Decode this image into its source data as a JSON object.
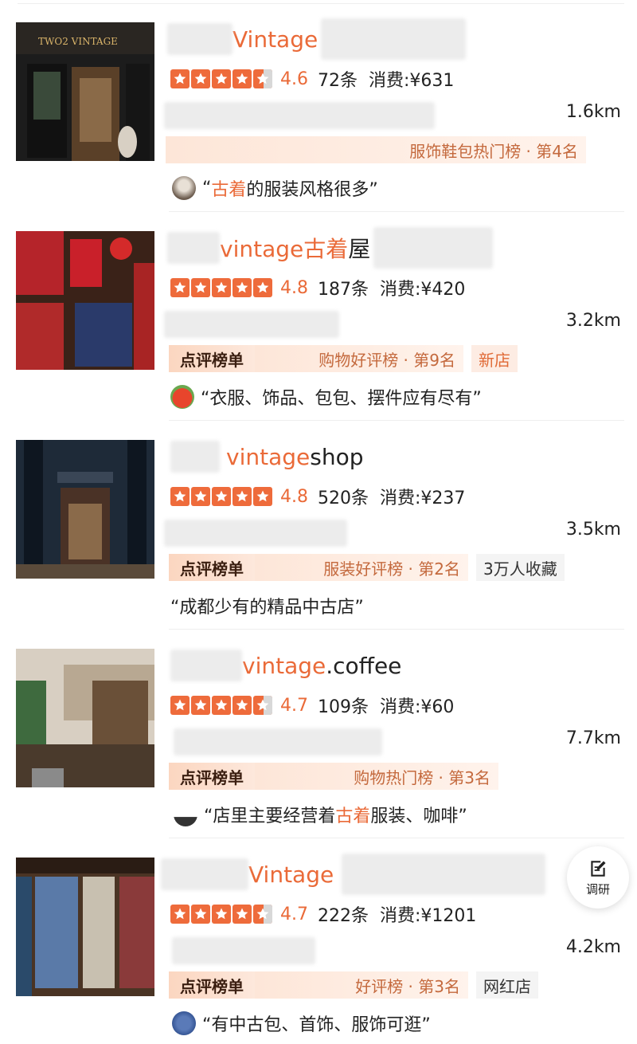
{
  "shops": [
    {
      "name_highlight": "Vintage",
      "name_tail": "",
      "score": "4.6",
      "stars": 4.5,
      "reviews": "72条",
      "price": "消费:¥631",
      "distance": "1.6km",
      "rank_badge": "",
      "rank_text": "服饰鞋包热门榜 · 第4名",
      "extra_tag": "",
      "review_pre": "“",
      "review_hl": "古着",
      "review_post": "的服装风格很多”"
    },
    {
      "name_highlight": "vintage古着",
      "name_tail": "屋",
      "score": "4.8",
      "stars": 5,
      "reviews": "187条",
      "price": "消费:¥420",
      "distance": "3.2km",
      "rank_badge": "点评榜单",
      "rank_text": "购物好评榜 · 第9名",
      "extra_tag": "新店",
      "review_pre": "“衣服、饰品、包包、摆件应有尽有”",
      "review_hl": "",
      "review_post": ""
    },
    {
      "name_highlight": "vintage",
      "name_tail": " shop",
      "score": "4.8",
      "stars": 5,
      "reviews": "520条",
      "price": "消费:¥237",
      "distance": "3.5km",
      "rank_badge": "点评榜单",
      "rank_text": "服装好评榜 · 第2名",
      "extra_tag": "3万人收藏",
      "review_pre": "“成都少有的精品中古店”",
      "review_hl": "",
      "review_post": ""
    },
    {
      "name_highlight": "vintage",
      "name_tail": ".coffee",
      "score": "4.7",
      "stars": 4.5,
      "reviews": "109条",
      "price": "消费:¥60",
      "distance": "7.7km",
      "rank_badge": "点评榜单",
      "rank_text": "购物热门榜 · 第3名",
      "extra_tag": "",
      "review_pre": "“店里主要经营着",
      "review_hl": "古着",
      "review_post": "服装、咖啡”"
    },
    {
      "name_highlight": "Vintage",
      "name_tail": "",
      "score": "4.7",
      "stars": 4.5,
      "reviews": "222条",
      "price": "消费:¥1201",
      "distance": "4.2km",
      "rank_badge": "点评榜单",
      "rank_text": "好评榜 · 第3名",
      "extra_tag": "网红店",
      "review_pre": "“有中古包、首饰、服饰可逛”",
      "review_hl": "",
      "review_post": ""
    }
  ],
  "thumb_sign": "TWO2 VINTAGE",
  "float_button": {
    "icon": "edit-note-icon",
    "label": "调研"
  },
  "colors": {
    "accent": "#ea6a38",
    "star": "#ee6b3b",
    "rank_text": "#c4693d"
  }
}
